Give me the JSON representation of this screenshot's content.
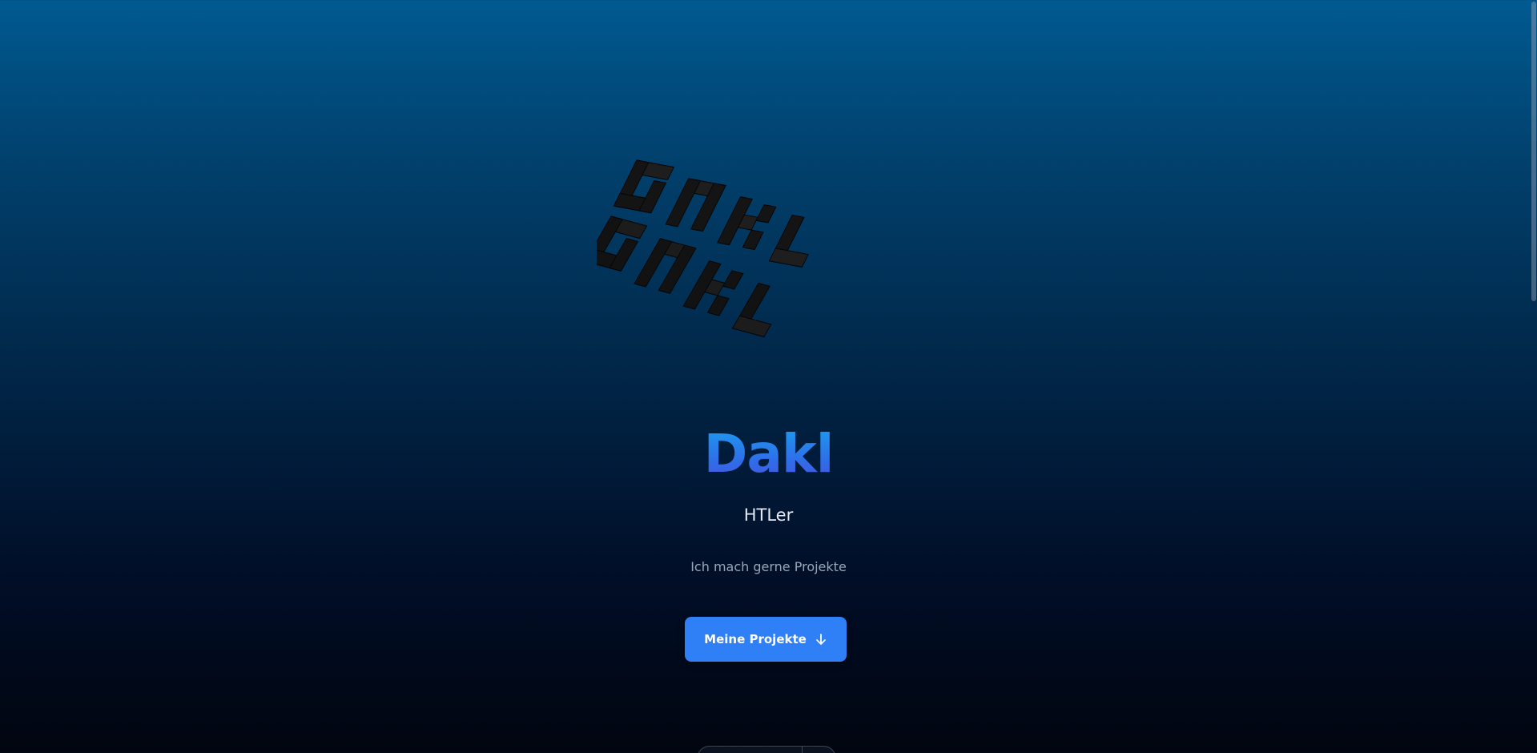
{
  "hero": {
    "logo_icon": "blocky-3d-logo-icon",
    "title": "Dakl",
    "subtitle": "HTLer",
    "tagline": "Ich mach gerne Projekte",
    "cta_label": "Meine Projekte",
    "cta_icon": "arrow-down-icon"
  },
  "colors": {
    "background_top": "#005a91",
    "background_bottom": "#01050f",
    "title_gradient_start": "#1aa0f0",
    "title_gradient_end": "#4a50e0",
    "cta_background": "#2f7ff7",
    "cta_text": "#ffffff",
    "subtitle_text": "#e3e9f2",
    "tagline_text": "#98a6b8"
  }
}
